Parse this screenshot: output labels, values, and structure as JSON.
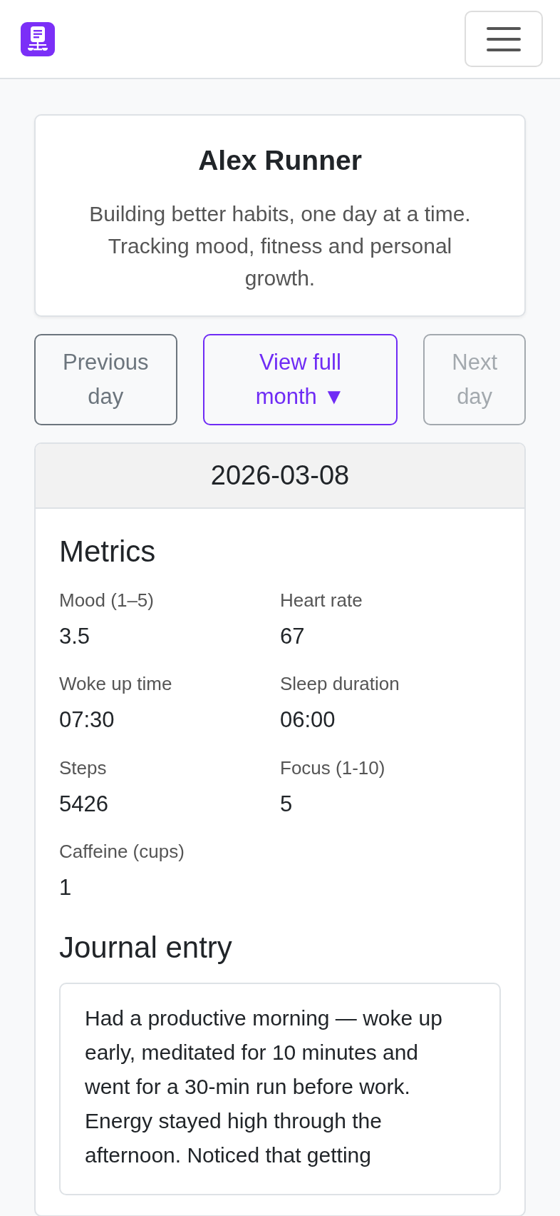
{
  "profile": {
    "name": "Alex Runner",
    "bio": "Building better habits, one day at a time. Tracking mood, fitness and personal growth."
  },
  "nav_buttons": [
    {
      "kind": "previous",
      "label": "Previous day",
      "disabled": false
    },
    {
      "kind": "month",
      "label": "View full month",
      "caret": "▼",
      "disabled": false
    },
    {
      "kind": "next",
      "label": "Next day",
      "disabled": true
    }
  ],
  "day": {
    "date": "2026-03-08",
    "metrics_title": "Metrics",
    "metrics": [
      {
        "label": "Mood (1–5)",
        "value": "3.5"
      },
      {
        "label": "Heart rate",
        "value": "67"
      },
      {
        "label": "Woke up time",
        "value": "07:30"
      },
      {
        "label": "Sleep duration",
        "value": "06:00"
      },
      {
        "label": "Steps",
        "value": "5426"
      },
      {
        "label": "Focus (1-10)",
        "value": "5"
      },
      {
        "label": "Caffeine (cups)",
        "value": "1"
      }
    ],
    "journal_title": "Journal entry",
    "journal_text": "Had a productive morning — woke up early, meditated for 10 minutes and went for a 30-min run before work. Energy stayed high through the afternoon. Noticed that getting"
  }
}
